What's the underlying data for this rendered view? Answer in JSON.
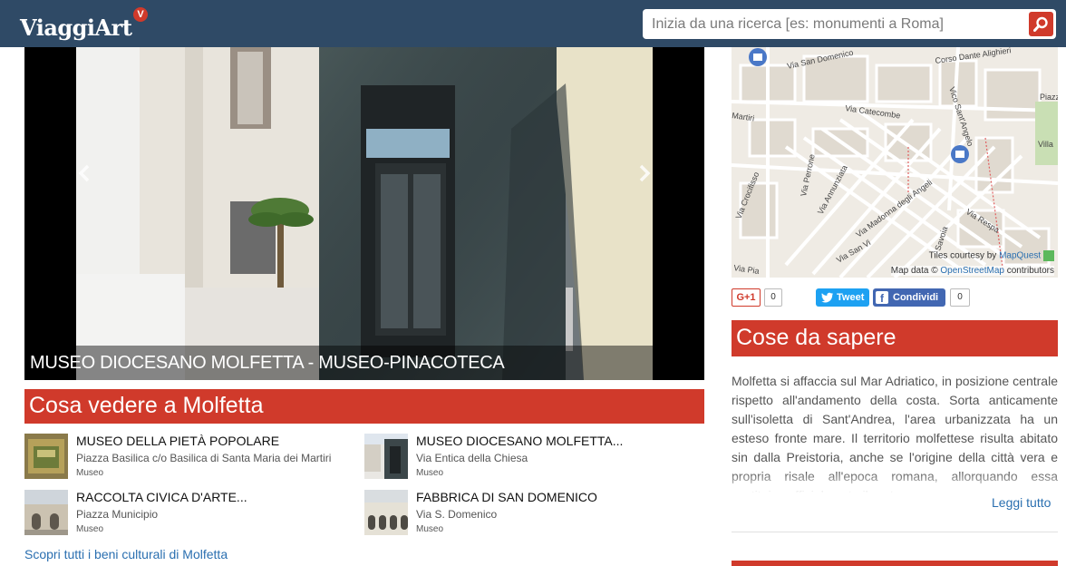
{
  "header": {
    "logo_text": "ViaggiArt",
    "logo_badge": "V",
    "search_placeholder": "Inizia da una ricerca [es: monumenti a Roma]",
    "brand_color": "#2f4a66",
    "accent_color": "#d03a2b",
    "search_icon": "search-icon"
  },
  "slider": {
    "caption": "MUSEO DIOCESANO MOLFETTA - MUSEO-PINACOTECA",
    "prev_icon": "chevron-left-icon",
    "next_icon": "chevron-right-icon"
  },
  "what_to_see": {
    "title": "Cosa vedere a Molfetta",
    "items": [
      {
        "title": "MUSEO DELLA PIETÀ POPOLARE",
        "address": "Piazza Basilica c/o Basilica di Santa Maria dei Martiri",
        "type": "Museo"
      },
      {
        "title": "MUSEO DIOCESANO MOLFETTA...",
        "address": "Via Entica della Chiesa",
        "type": "Museo"
      },
      {
        "title": "RACCOLTA CIVICA D'ARTE...",
        "address": "Piazza Municipio",
        "type": "Museo"
      },
      {
        "title": "FABBRICA DI SAN DOMENICO",
        "address": "Via S. Domenico",
        "type": "Museo"
      }
    ],
    "discover_link": "Scopri tutti i beni culturali di Molfetta"
  },
  "map": {
    "streets": [
      "Via San Domenico",
      "Corso Dante Alighieri",
      "Via Catecombe",
      "Martiri",
      "Vico Sant'Angelo",
      "Via Perrone",
      "Via Annunziata",
      "Via Crocifisso",
      "Via Madonna degli Angeli",
      "Via Respa",
      "Via San Vi",
      "Via Pia",
      "Villa",
      "Piazz",
      "Savoia"
    ],
    "tiles_prefix": "Tiles courtesy by ",
    "tiles_link": "MapQuest",
    "data_prefix": "Map data © ",
    "data_link": "OpenStreetMap",
    "data_suffix": " contributors"
  },
  "share": {
    "gplus_label": "G+1",
    "gplus_count": "0",
    "tweet_label": "Tweet",
    "facebook_label": "Condividi",
    "facebook_count": "0"
  },
  "about": {
    "title": "Cose da sapere",
    "text": "Molfetta si affaccia sul Mar Adriatico, in posizione centrale rispetto all'andamento della costa. Sorta anticamente sull'isoletta di Sant'Andrea, l'area urbanizzata ha un esteso fronte mare. Il territorio molfettese risulta abitato sin dalla Preistoria, anche se l'origine della città vera e propria risale all'epoca romana, allorquando essa costituiva ufficialmente il porto",
    "read_more": "Leggi tutto"
  }
}
